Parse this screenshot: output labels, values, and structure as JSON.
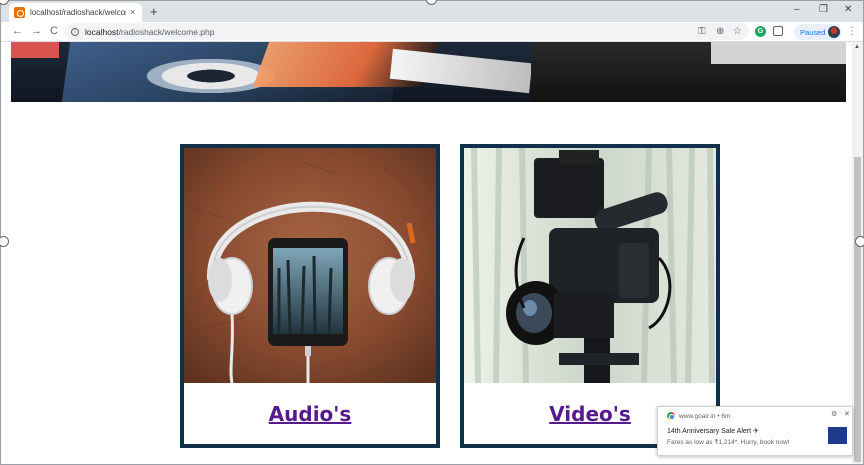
{
  "browser": {
    "tab_title": "localhost/radioshack/welcome.p",
    "tab_close": "×",
    "new_tab": "+",
    "window_minimize": "–",
    "window_maximize": "❐",
    "window_close": "✕",
    "back": "←",
    "forward": "→",
    "reload": "C",
    "url_host": "localhost",
    "url_path": "/radioshack/welcome.php",
    "profile_status": "Paused",
    "menu": "⋮"
  },
  "cards": [
    {
      "label": "Audio's",
      "image": "headphones-phone-photo"
    },
    {
      "label": "Video's",
      "image": "video-camera-photo"
    }
  ],
  "notification": {
    "source": "www.goair.in",
    "age": "6m",
    "title": "14th Anniversary Sale Alert ✈",
    "body": "Fares as low as ₹1,214*. Hurry, book now!",
    "logo_text": "GO"
  },
  "colors": {
    "card_border": "#12304a",
    "link": "#551a8b"
  }
}
